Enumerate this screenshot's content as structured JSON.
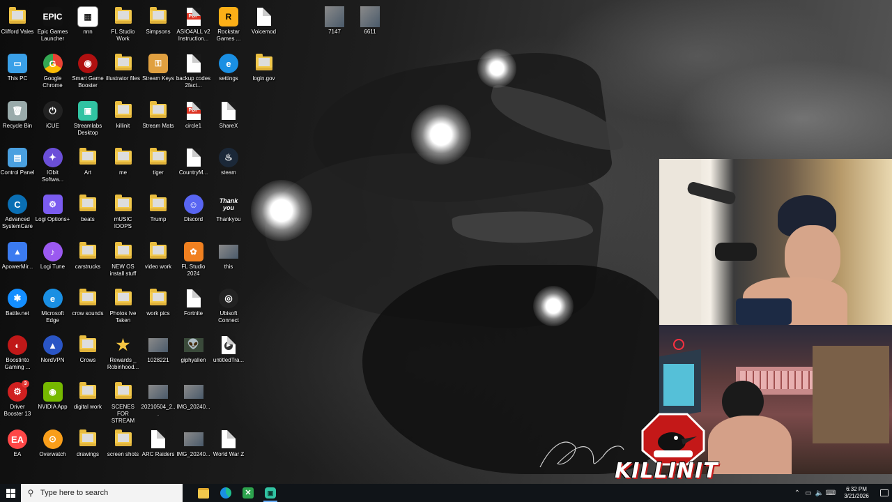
{
  "desktop": {
    "icons": [
      {
        "label": "Clifford Vales",
        "icon": "folder-icon"
      },
      {
        "label": "Epic Games Launcher",
        "icon": "epic-games-icon"
      },
      {
        "label": "nnn",
        "icon": "program-window-icon"
      },
      {
        "label": "FL Studio Work",
        "icon": "folder-icon"
      },
      {
        "label": "Simpsons",
        "icon": "folder-icon"
      },
      {
        "label": "ASIO4ALL v2 Instruction...",
        "icon": "pdf-icon"
      },
      {
        "label": "Rockstar Games ...",
        "icon": "rockstar-icon"
      },
      {
        "label": "Voicemod",
        "icon": "file-icon"
      },
      {
        "label": "This PC",
        "icon": "this-pc-icon"
      },
      {
        "label": "Google Chrome",
        "icon": "chrome-icon"
      },
      {
        "label": "Smart Game Booster",
        "icon": "game-booster-icon"
      },
      {
        "label": "illustrator files",
        "icon": "folder-icon"
      },
      {
        "label": "Stream Keys",
        "icon": "key-icon"
      },
      {
        "label": "backup codes 2fact...",
        "icon": "file-icon"
      },
      {
        "label": "settings",
        "icon": "edge-icon"
      },
      {
        "label": "login.gov",
        "icon": "folder-icon"
      },
      {
        "label": "Recycle Bin",
        "icon": "recycle-bin-icon"
      },
      {
        "label": "iCUE",
        "icon": "icue-icon"
      },
      {
        "label": "Streamlabs Desktop",
        "icon": "streamlabs-icon"
      },
      {
        "label": "killinit",
        "icon": "folder-icon"
      },
      {
        "label": "Stream Mats",
        "icon": "folder-icon"
      },
      {
        "label": "circle1",
        "icon": "pdf-icon"
      },
      {
        "label": "ShareX",
        "icon": "file-icon"
      },
      {
        "label": "Control Panel",
        "icon": "control-panel-icon"
      },
      {
        "label": "IObit Softwa...",
        "icon": "iobit-icon"
      },
      {
        "label": "Art",
        "icon": "folder-icon"
      },
      {
        "label": "me",
        "icon": "folder-icon"
      },
      {
        "label": "tiger",
        "icon": "folder-icon"
      },
      {
        "label": "CountryM...",
        "icon": "file-icon"
      },
      {
        "label": "steam",
        "icon": "steam-icon"
      },
      {
        "label": "Advanced SystemCare",
        "icon": "advanced-systemcare-icon"
      },
      {
        "label": "Logi Options+",
        "icon": "logi-options-icon"
      },
      {
        "label": "beats",
        "icon": "folder-icon"
      },
      {
        "label": "mUSIC lOOPS",
        "icon": "folder-icon"
      },
      {
        "label": "Trump",
        "icon": "folder-icon"
      },
      {
        "label": "Discord",
        "icon": "discord-icon"
      },
      {
        "label": "Thankyou",
        "icon": "thankyou-image-icon"
      },
      {
        "label": "ApowerMir...",
        "icon": "apowermirror-icon"
      },
      {
        "label": "Logi Tune",
        "icon": "logi-tune-icon"
      },
      {
        "label": "carstrucks",
        "icon": "folder-icon"
      },
      {
        "label": "NEW OS install stuff",
        "icon": "folder-icon"
      },
      {
        "label": "video work",
        "icon": "folder-icon"
      },
      {
        "label": "FL Studio 2024",
        "icon": "fl-studio-icon"
      },
      {
        "label": "this",
        "icon": "image-icon"
      },
      {
        "label": "Battle.net",
        "icon": "battlenet-icon"
      },
      {
        "label": "Microsoft Edge",
        "icon": "edge-icon"
      },
      {
        "label": "crow sounds",
        "icon": "folder-icon"
      },
      {
        "label": "Photos Ive Taken",
        "icon": "folder-icon"
      },
      {
        "label": "work pics",
        "icon": "folder-icon"
      },
      {
        "label": "Fortnite",
        "icon": "file-icon"
      },
      {
        "label": "Ubisoft Connect",
        "icon": "ubisoft-icon"
      },
      {
        "label": "Boostinto Gaming ...",
        "icon": "booster-icon"
      },
      {
        "label": "NordVPN",
        "icon": "nordvpn-icon"
      },
      {
        "label": "Crows",
        "icon": "folder-icon"
      },
      {
        "label": "Rewards _ Robinhood...",
        "icon": "star-icon"
      },
      {
        "label": "1028221",
        "icon": "image-icon"
      },
      {
        "label": "giphyalien",
        "icon": "alien-image-icon"
      },
      {
        "label": "untitledTra...",
        "icon": "video-file-icon"
      },
      {
        "label": "Driver Booster 13",
        "icon": "driver-booster-icon"
      },
      {
        "label": "NVIDIA App",
        "icon": "nvidia-icon"
      },
      {
        "label": "digital work",
        "icon": "folder-icon"
      },
      {
        "label": "SCENES FOR STREAM",
        "icon": "folder-icon"
      },
      {
        "label": "20210504_2...",
        "icon": "image-icon"
      },
      {
        "label": "IMG_20240...",
        "icon": "image-icon"
      },
      {
        "label": "EA",
        "icon": "ea-icon"
      },
      {
        "label": "Overwatch",
        "icon": "overwatch-icon"
      },
      {
        "label": "drawings",
        "icon": "folder-icon"
      },
      {
        "label": "screen shots",
        "icon": "folder-icon"
      },
      {
        "label": "ARC Raiders",
        "icon": "file-icon"
      },
      {
        "label": "IMG_20240...",
        "icon": "image-icon"
      },
      {
        "label": "World War Z",
        "icon": "file-icon"
      },
      {
        "label": "7147",
        "icon": "photo-icon"
      },
      {
        "label": "6611",
        "icon": "photo-icon"
      }
    ],
    "driver_booster_badge": "3"
  },
  "overlay": {
    "logo_text": "KILLINIT",
    "cam_top": "webcam-face",
    "cam_bottom": "webcam-desk"
  },
  "taskbar": {
    "search_placeholder": "Type here to search",
    "apps": [
      "file-explorer-icon",
      "edge-icon",
      "xbox-icon",
      "streamlabs-icon"
    ],
    "clock_time": "6:32 PM",
    "clock_date": "3/21/2026"
  }
}
